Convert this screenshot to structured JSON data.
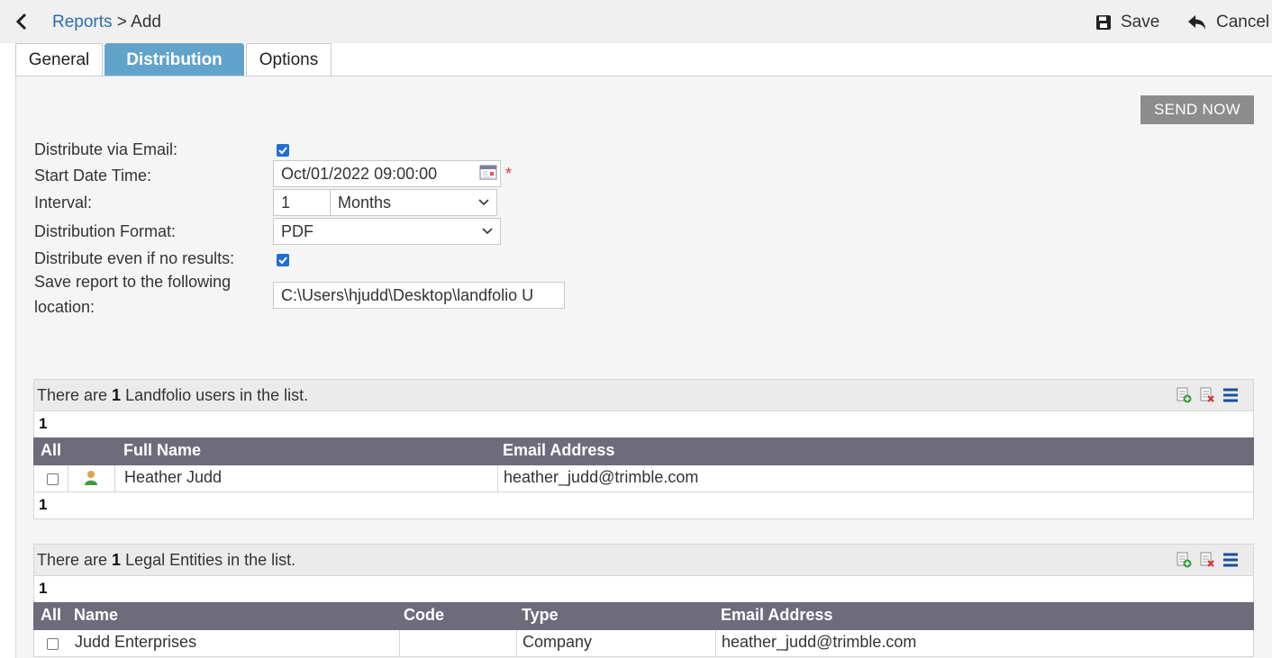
{
  "breadcrumb": {
    "parent": "Reports",
    "separator": " > ",
    "current": "Add"
  },
  "toolbar": {
    "save_label": "Save",
    "cancel_label": "Cancel"
  },
  "tabs": [
    {
      "label": "General",
      "active": false
    },
    {
      "label": "Distribution",
      "active": true
    },
    {
      "label": "Options",
      "active": false
    }
  ],
  "send_now_label": "SEND NOW",
  "form": {
    "distribute_email_label": "Distribute via Email:",
    "distribute_email_checked": true,
    "start_label": "Start Date Time:",
    "start_value": "Oct/01/2022 09:00:00",
    "required_mark": "*",
    "interval_label": "Interval:",
    "interval_value": "1",
    "interval_unit": "Months",
    "format_label": "Distribution Format:",
    "format_value": "PDF",
    "no_results_label": "Distribute even if no results:",
    "no_results_checked": true,
    "save_location_label_line1": "Save report to the following",
    "save_location_label_line2": "location:",
    "save_location_value": "C:\\Users\\hjudd\\Desktop\\landfolio U"
  },
  "users_grid": {
    "summary_prefix": "There are ",
    "summary_count": "1",
    "summary_suffix": " Landfolio users in the list.",
    "page_top": "1",
    "page_bottom": "1",
    "columns": [
      "All",
      "",
      "Full Name",
      "Email Address"
    ],
    "rows": [
      {
        "full_name": "Heather Judd",
        "email": "heather_judd@trimble.com",
        "icon": "user-icon"
      }
    ]
  },
  "entities_grid": {
    "summary_prefix": "There are ",
    "summary_count": "1",
    "summary_suffix": " Legal Entities in the list.",
    "page_top": "1",
    "columns": [
      "All",
      "Name",
      "Code",
      "Type",
      "Email Address"
    ],
    "rows": [
      {
        "name": "Judd Enterprises",
        "code": "",
        "type": "Company",
        "email": "heather_judd@trimble.com"
      }
    ]
  },
  "colors": {
    "accent": "#62a3cc",
    "link": "#2a6fb0",
    "grid_header": "#6e6b7b",
    "checkbox": "#1f6fd1"
  }
}
